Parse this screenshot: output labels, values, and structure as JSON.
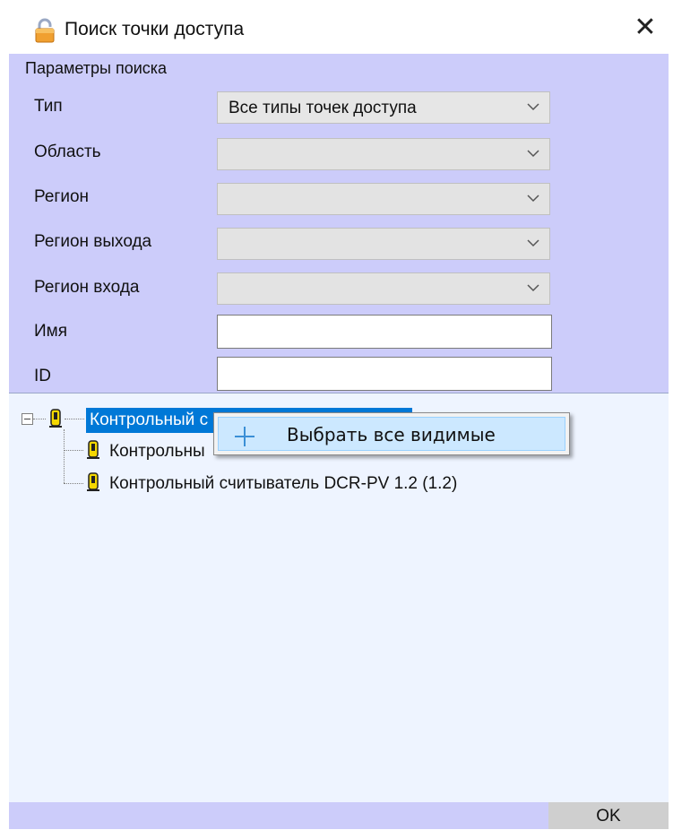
{
  "window": {
    "title": "Поиск точки доступа",
    "close_glyph": "✕",
    "icons": {
      "title": "lock-icon",
      "close": "close-icon"
    }
  },
  "params": {
    "group_label": "Параметры поиска",
    "fields": [
      {
        "label": "Тип",
        "kind": "combo",
        "value": "Все типы точек доступа"
      },
      {
        "label": "Область",
        "kind": "combo",
        "value": ""
      },
      {
        "label": "Регион",
        "kind": "combo",
        "value": ""
      },
      {
        "label": "Регион выхода",
        "kind": "combo",
        "value": ""
      },
      {
        "label": "Регион входа",
        "kind": "combo",
        "value": ""
      },
      {
        "label": "Имя",
        "kind": "text",
        "value": ""
      },
      {
        "label": "ID",
        "kind": "text",
        "value": ""
      }
    ]
  },
  "tree": {
    "root": {
      "label": "Контрольный с",
      "expanded": true,
      "selected": true
    },
    "children": [
      {
        "label": "Контрольны"
      },
      {
        "label": "Контрольный считыватель DCR-PV 1.2 (1.2)"
      }
    ]
  },
  "context_menu": {
    "items": [
      {
        "label": "Выбрать все видимые",
        "icon": "plus-icon"
      }
    ]
  },
  "footer": {
    "ok_label": "OK"
  },
  "colors": {
    "panel": "#ccccfa",
    "tree_bg": "#eef4ff",
    "selection": "#0078d7",
    "menu_hover": "#cce8ff"
  }
}
